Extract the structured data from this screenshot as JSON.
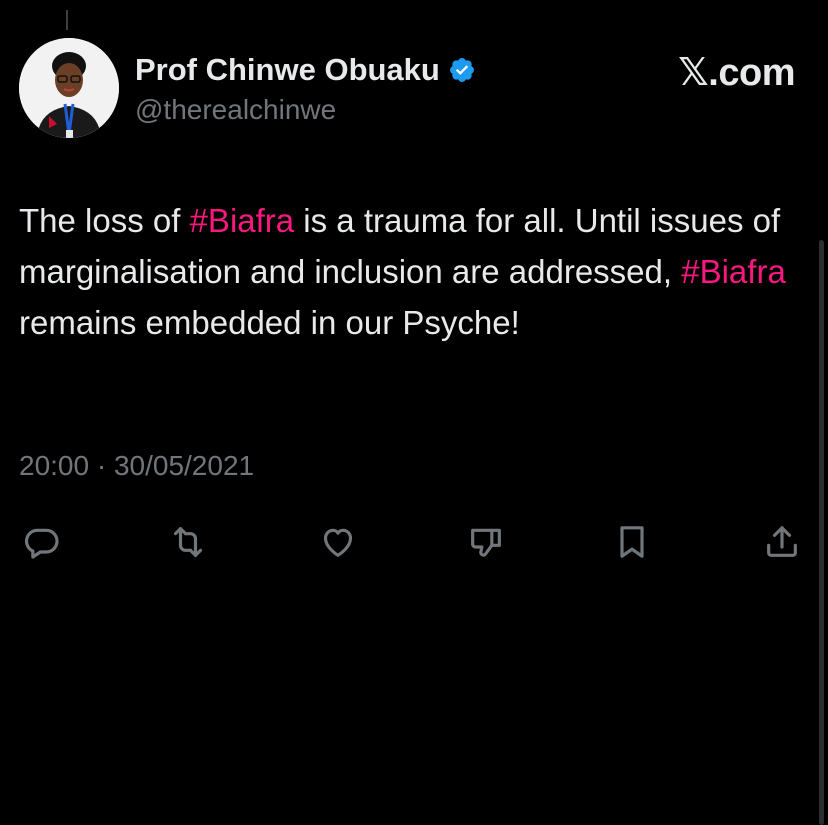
{
  "author": {
    "display_name": "Prof Chinwe Obuaku",
    "handle": "@therealchinwe",
    "verified": true,
    "avatar": "person-avatar"
  },
  "source": {
    "logo_glyph": "𝕏",
    "logo_suffix": ".com"
  },
  "tweet": {
    "segments": [
      {
        "text": "The loss of ",
        "hashtag": false
      },
      {
        "text": "#Biafra",
        "hashtag": true
      },
      {
        "text": " is a trauma for all. Until issues of marginalisation and inclusion are addressed, ",
        "hashtag": false
      },
      {
        "text": "#Biafra",
        "hashtag": true
      },
      {
        "text": " remains embedded in our Psyche!",
        "hashtag": false
      }
    ],
    "timestamp": "20:00 · 30/05/2021"
  },
  "actions": [
    "reply-icon",
    "retweet-icon",
    "like-icon",
    "dislike-icon",
    "bookmark-icon",
    "share-icon"
  ],
  "colors": {
    "background": "#000000",
    "text": "#e7e9ea",
    "muted": "#71767b",
    "hashtag": "#f91880",
    "verified": "#1d9bf0"
  }
}
